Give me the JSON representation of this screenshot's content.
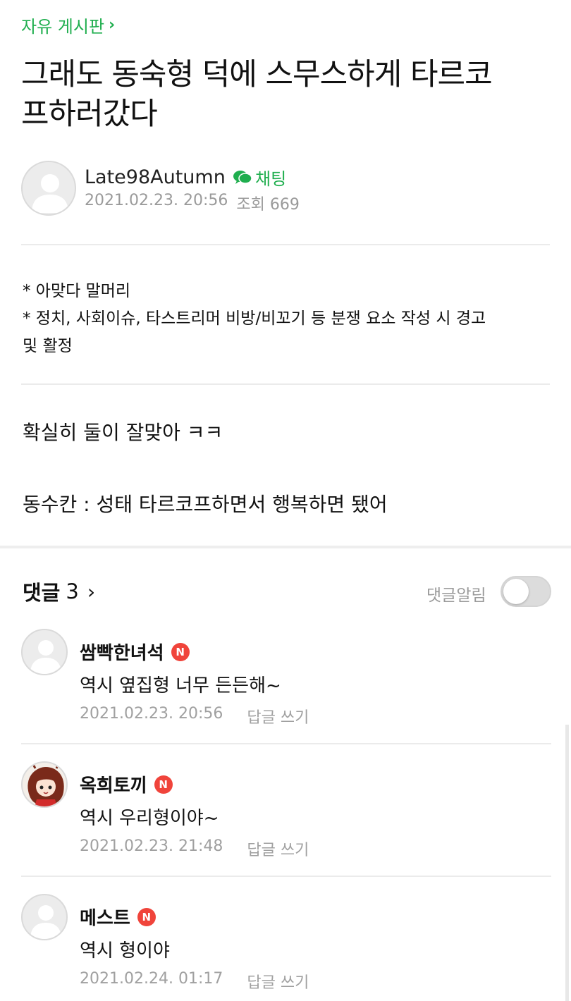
{
  "board": {
    "label": "자유 게시판",
    "chevron": "›"
  },
  "post": {
    "title_line1": "그래도 동숙형 덕에 스무스하게 타르코",
    "title_line2": "프하러갔다",
    "author": "Late98Autumn",
    "chat_label": "채팅",
    "datetime": "2021.02.23. 20:56",
    "views_label": "조회 669",
    "notice_line1": "* 아맞다 말머리",
    "notice_line2": "* 정치, 사회이슈, 타스트리머 비방/비꼬기 등 분쟁 요소 작성 시 경고",
    "notice_line3": "및 활정",
    "body_line1": "확실히 둘이 잘맞아 ㅋㅋ",
    "body_line2": "동수칸 : 성태 타르코프하면서 행복하면 됐어"
  },
  "comments_section": {
    "label": "댓글",
    "count": "3",
    "chevron": "›",
    "notify_label": "댓글알림",
    "notify_enabled": false
  },
  "comments": [
    {
      "author": "쌈빡한녀석",
      "badge": "N",
      "text": "역시 옆집형 너무 든든해~",
      "datetime": "2021.02.23. 20:56",
      "reply_label": "답글 쓰기",
      "avatar": "default-avatar-icon"
    },
    {
      "author": "옥희토끼",
      "badge": "N",
      "text": "역시 우리형이야~",
      "datetime": "2021.02.23. 21:48",
      "reply_label": "답글 쓰기",
      "avatar": "anime-character-avatar"
    },
    {
      "author": "메스트",
      "badge": "N",
      "text": "역시 형이야",
      "datetime": "2021.02.24. 01:17",
      "reply_label": "답글 쓰기",
      "avatar": "default-avatar-icon"
    }
  ],
  "colors": {
    "accent_green": "#1fae4e",
    "badge_red": "#f0443b",
    "meta_gray": "#9a9a9a"
  }
}
